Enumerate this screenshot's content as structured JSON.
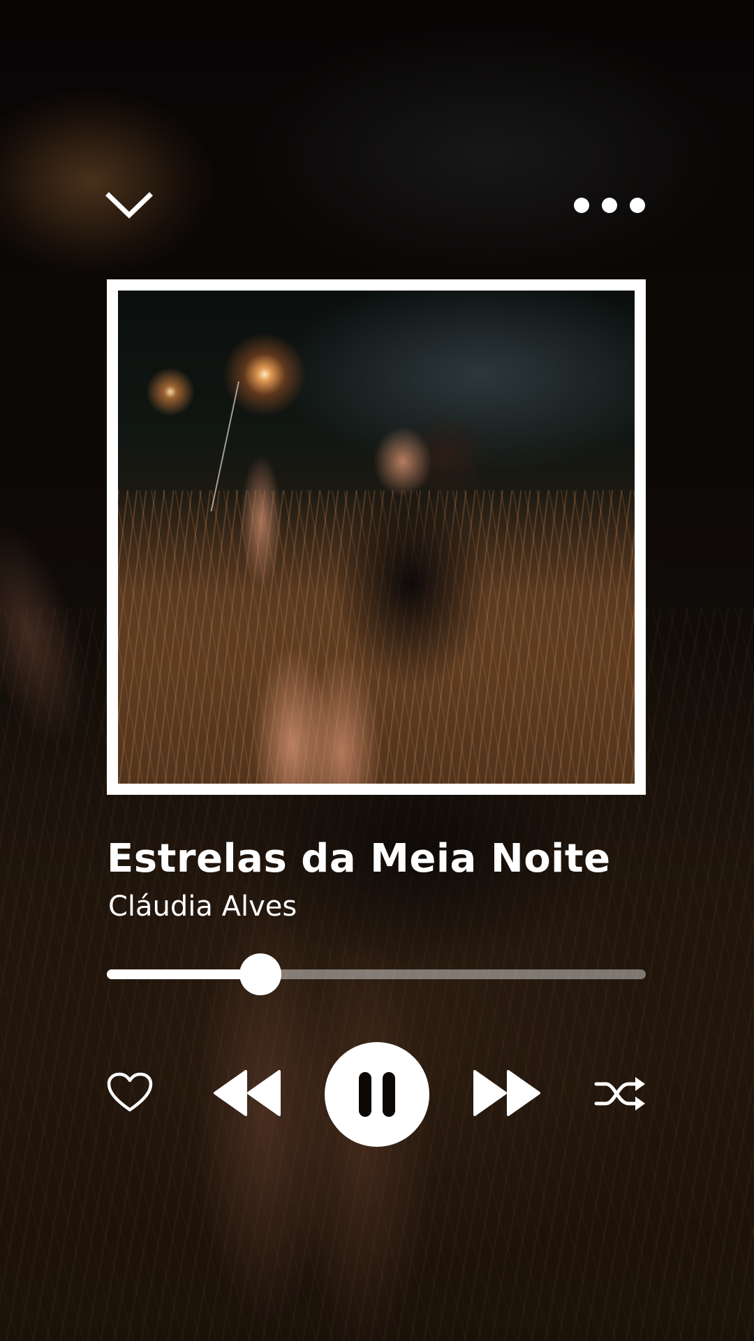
{
  "track": {
    "title": "Estrelas da Meia Noite",
    "artist": "Cláudia Alves"
  },
  "playback": {
    "progress": 0.285,
    "state": "playing"
  },
  "icons": {
    "collapse": "chevron-down-icon",
    "more": "more-options-icon",
    "like": "heart-icon",
    "previous": "rewind-icon",
    "play_pause": "pause-icon",
    "next": "fast-forward-icon",
    "shuffle": "shuffle-icon"
  },
  "colors": {
    "foreground": "#ffffff",
    "progress_track": "rgba(255,255,255,0.42)",
    "background": "#0b0806"
  }
}
